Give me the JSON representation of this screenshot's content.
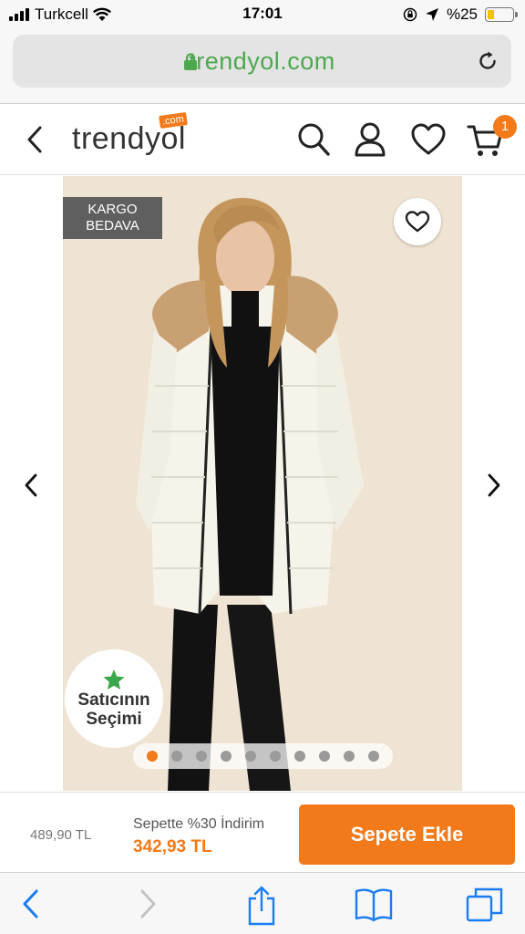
{
  "status_bar": {
    "carrier": "Turkcell",
    "time": "17:01",
    "battery_text": "%25",
    "battery_level": 0.25
  },
  "browser": {
    "url": "trendyol.com"
  },
  "header": {
    "logo_text": "trendyol",
    "logo_suffix": ".com",
    "cart_count": "1"
  },
  "product": {
    "badge_line1": "KARGO",
    "badge_line2": "BEDAVA",
    "seller_line1": "Satıcının",
    "seller_line2": "Seçimi",
    "image_count": 10,
    "active_image": 0
  },
  "purchase": {
    "old_price": "489,90 TL",
    "promo_label": "Sepette %30 İndirim",
    "promo_price": "342,93 TL",
    "add_to_cart": "Sepete Ekle"
  },
  "colors": {
    "brand": "#f27a1a",
    "url_green": "#4ea84e",
    "badge_gray": "#5f5f5f",
    "ios_blue": "#1a7cf4"
  }
}
